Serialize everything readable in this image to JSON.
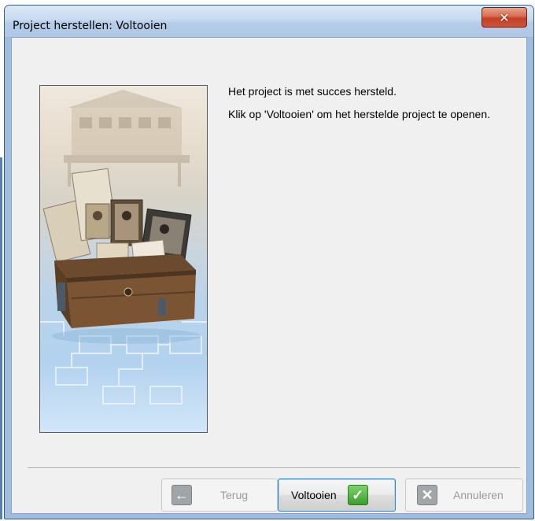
{
  "window": {
    "title": "Project herstellen: Voltooien",
    "close_glyph": "✕"
  },
  "message": {
    "line1": "Het project is met succes hersteld.",
    "line2": "Klik op 'Voltooien' om het herstelde project te openen."
  },
  "buttons": {
    "back": {
      "label": "Terug",
      "icon": "arrow-left-icon",
      "enabled": false
    },
    "finish": {
      "label": "Voltooien",
      "icon": "check-icon",
      "enabled": true,
      "default": true
    },
    "cancel": {
      "label": "Annuleren",
      "icon": "x-icon",
      "enabled": false
    }
  },
  "colors": {
    "title_bar": "#c7daf0",
    "close_button": "#c44125",
    "client_bg": "#f0f0f0",
    "check_green": "#3b9e2b"
  }
}
